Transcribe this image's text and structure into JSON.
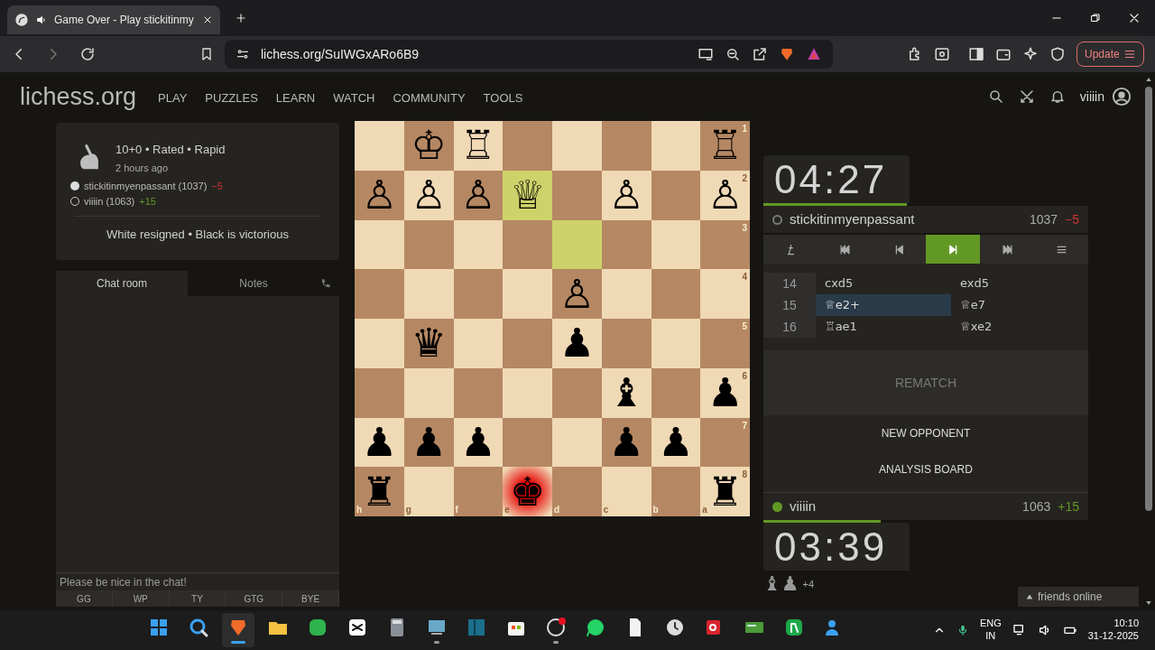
{
  "browser": {
    "tab_title": "Game Over - Play stickitinmy",
    "url": "lichess.org/SuIWGxARo6B9",
    "update_button": "Update"
  },
  "site": {
    "logo": "lichess.org",
    "nav": [
      "PLAY",
      "PUZZLES",
      "LEARN",
      "WATCH",
      "COMMUNITY",
      "TOOLS"
    ],
    "username": "viiiin"
  },
  "game_info": {
    "title": "10+0 • Rated • Rapid",
    "time": "2 hours ago",
    "status": "White resigned • Black is victorious",
    "players": [
      {
        "name": "stickitinmyenpassant (1037)",
        "diff": "−5",
        "white_pieces": true,
        "won": false
      },
      {
        "name": "viiiin (1063)",
        "diff": "+15",
        "white_pieces": false,
        "won": true
      }
    ]
  },
  "chat": {
    "tabs": [
      {
        "label": "Chat room",
        "selected": true
      },
      {
        "label": "Notes",
        "selected": false
      }
    ],
    "placeholder": "Please be nice in the chat!",
    "quick_replies": [
      "GG",
      "WP",
      "TY",
      "GTG",
      "BYE"
    ]
  },
  "board": {
    "ranks": [
      "1",
      "2",
      "3",
      "4",
      "5",
      "6",
      "7",
      "8"
    ],
    "files": [
      "h",
      "g",
      "f",
      "e",
      "d",
      "c",
      "b",
      "a"
    ],
    "rows": [
      [
        {},
        {
          "piece": "♔"
        },
        {
          "piece": "♖"
        },
        {},
        {},
        {},
        {},
        {
          "piece": "♖"
        }
      ],
      [
        {
          "piece": "♙"
        },
        {
          "piece": "♙"
        },
        {
          "piece": "♙"
        },
        {
          "piece": "♕",
          "last_move": true
        },
        {},
        {
          "piece": "♙"
        },
        {},
        {
          "piece": "♙"
        }
      ],
      [
        {},
        {},
        {},
        {},
        {
          "last_move": true
        },
        {},
        {},
        {}
      ],
      [
        {},
        {},
        {},
        {},
        {
          "piece": "♙"
        },
        {},
        {},
        {}
      ],
      [
        {},
        {
          "piece": "♛"
        },
        {},
        {},
        {
          "piece": "♟"
        },
        {},
        {},
        {}
      ],
      [
        {},
        {},
        {},
        {},
        {},
        {
          "piece": "♝"
        },
        {},
        {
          "piece": "♟"
        }
      ],
      [
        {
          "piece": "♟"
        },
        {
          "piece": "♟"
        },
        {
          "piece": "♟"
        },
        {},
        {},
        {
          "piece": "♟"
        },
        {
          "piece": "♟"
        },
        {}
      ],
      [
        {
          "piece": "♜"
        },
        {},
        {},
        {
          "piece": "♚",
          "check": true
        },
        {},
        {},
        {},
        {
          "piece": "♜"
        }
      ]
    ]
  },
  "top_player": {
    "clock": "04:27",
    "level": 0.98,
    "name": "stickitinmyenpassant",
    "online": false,
    "rating": "1037",
    "diff": "−5",
    "won": false
  },
  "controls": [
    {
      "kind": "flip",
      "selected": false
    },
    {
      "kind": "first",
      "selected": false
    },
    {
      "kind": "prev",
      "selected": false
    },
    {
      "kind": "next",
      "selected": true
    },
    {
      "kind": "last",
      "selected": false
    },
    {
      "kind": "menu",
      "selected": false
    }
  ],
  "moves": [
    {
      "number": "14",
      "white": {
        "san": "cxd5",
        "selected": false
      },
      "black": {
        "san": "exd5",
        "selected": false
      }
    },
    {
      "number": "15",
      "white": {
        "san": "♕e2+",
        "selected": true
      },
      "black": {
        "san": "♕e7",
        "selected": false
      }
    },
    {
      "number": "16",
      "white": {
        "san": "♖ae1",
        "selected": false
      },
      "black": {
        "san": "♕xe2",
        "selected": false
      }
    }
  ],
  "actions": [
    {
      "label": "REMATCH",
      "kind": "rematch"
    },
    {
      "label": "NEW OPPONENT",
      "kind": "plain"
    },
    {
      "label": "ANALYSIS BOARD",
      "kind": "plain"
    }
  ],
  "bottom_player": {
    "name": "viiiin",
    "online": true,
    "rating": "1063",
    "diff": "+15",
    "won": true,
    "clock": "03:39",
    "level": 0.8
  },
  "material": {
    "pieces": "♝♟",
    "count": "+4"
  },
  "friends": "friends online",
  "taskbar": {
    "apps": [
      {
        "kind": "start",
        "active": false
      },
      {
        "kind": "search",
        "active": false
      },
      {
        "kind": "browser",
        "active": true
      },
      {
        "kind": "folder",
        "active": false
      },
      {
        "kind": "green-a",
        "active": false
      },
      {
        "kind": "capcut",
        "active": false
      },
      {
        "kind": "calculator",
        "active": false
      },
      {
        "kind": "monitor",
        "active": true
      },
      {
        "kind": "panel",
        "active": false
      },
      {
        "kind": "store",
        "active": false
      },
      {
        "kind": "obs",
        "active": true
      },
      {
        "kind": "whatsapp",
        "active": false
      },
      {
        "kind": "file",
        "active": false
      },
      {
        "kind": "clock",
        "active": false
      },
      {
        "kind": "red-app",
        "active": false
      },
      {
        "kind": "green-card",
        "active": false
      },
      {
        "kind": "green-app",
        "active": false
      },
      {
        "kind": "people",
        "active": false
      }
    ],
    "lang": "ENG",
    "region": "IN",
    "time": "10:10",
    "date": "31-12-2025"
  }
}
